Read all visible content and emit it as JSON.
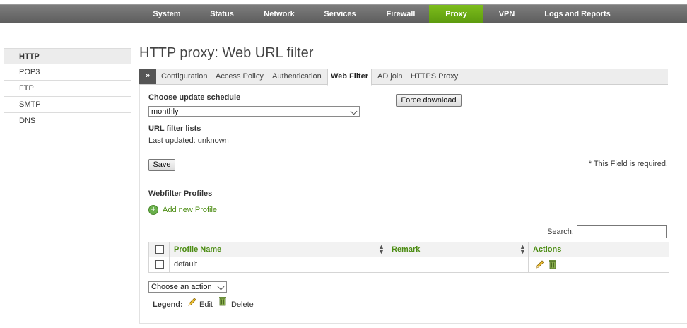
{
  "nav": {
    "items": [
      "System",
      "Status",
      "Network",
      "Services",
      "Firewall",
      "Proxy",
      "VPN",
      "Logs and Reports"
    ],
    "active": "Proxy",
    "active_color": "#6aac16"
  },
  "sidebar": {
    "items": [
      "HTTP",
      "POP3",
      "FTP",
      "SMTP",
      "DNS"
    ],
    "active": "HTTP"
  },
  "page": {
    "title": "HTTP proxy: Web URL filter"
  },
  "tabs": {
    "arrow": "»",
    "items": [
      "Configuration",
      "Access Policy",
      "Authentication",
      "Web Filter",
      "AD join",
      "HTTPS Proxy"
    ],
    "active": "Web Filter"
  },
  "schedule": {
    "label": "Choose update schedule",
    "value": "monthly",
    "force_button": "Force download"
  },
  "url_lists": {
    "label": "URL filter lists",
    "last_updated": "Last updated: unknown"
  },
  "save_button": "Save",
  "required_note": "* This Field is required.",
  "profiles": {
    "heading": "Webfilter Profiles",
    "add_link": "Add new Profile",
    "search_label": "Search:",
    "search_value": "",
    "columns": [
      "Profile Name",
      "Remark",
      "Actions"
    ],
    "rows": [
      {
        "name": "default",
        "remark": ""
      }
    ],
    "bulk_action": "Choose an action",
    "legend_label": "Legend:",
    "legend_edit": "Edit",
    "legend_delete": "Delete"
  }
}
